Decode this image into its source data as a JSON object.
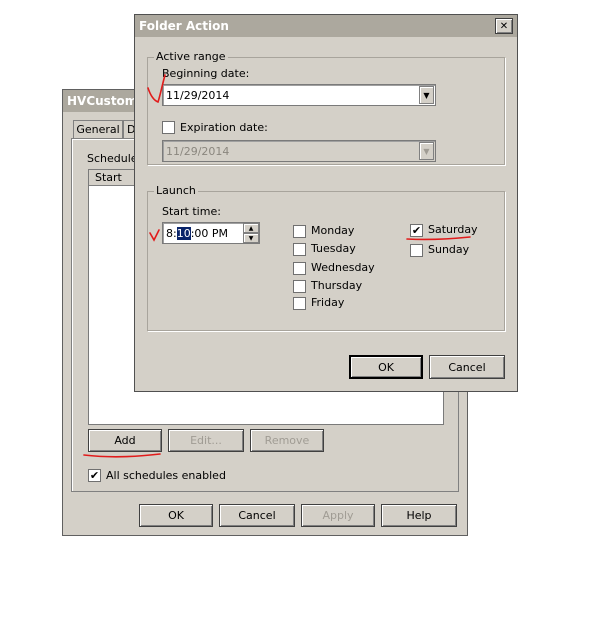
{
  "back_window": {
    "title": "HVCustomCo",
    "tabs": [
      "General",
      "D"
    ],
    "schedules_label": "Schedules",
    "column_start": "Start",
    "add_label": "Add",
    "edit_label": "Edit...",
    "remove_label": "Remove",
    "all_enabled_label": "All schedules enabled",
    "all_enabled_checked": true,
    "ok_label": "OK",
    "cancel_label": "Cancel",
    "apply_label": "Apply",
    "help_label": "Help"
  },
  "dialog": {
    "title": "Folder Action",
    "close_glyph": "✕",
    "active_range_label": "Active range",
    "beginning_date_label": "Beginning date:",
    "beginning_date_value": "11/29/2014",
    "expiration_label": "Expiration date:",
    "expiration_checked": false,
    "expiration_value": "11/29/2014",
    "launch_label": "Launch",
    "start_time_label": "Start time:",
    "time_hour": "8:",
    "time_minute": "10",
    "time_rest": ":00 PM",
    "days": [
      {
        "label": "Monday",
        "checked": false
      },
      {
        "label": "Tuesday",
        "checked": false
      },
      {
        "label": "Wednesday",
        "checked": false
      },
      {
        "label": "Thursday",
        "checked": false
      },
      {
        "label": "Friday",
        "checked": false
      },
      {
        "label": "Saturday",
        "checked": true
      },
      {
        "label": "Sunday",
        "checked": false
      }
    ],
    "ok_label": "OK",
    "cancel_label": "Cancel"
  },
  "check_glyph": "✔",
  "dropdown_glyph": "▼",
  "spin_up_glyph": "▲",
  "spin_down_glyph": "▼",
  "annotation_color": "#e11b1b"
}
